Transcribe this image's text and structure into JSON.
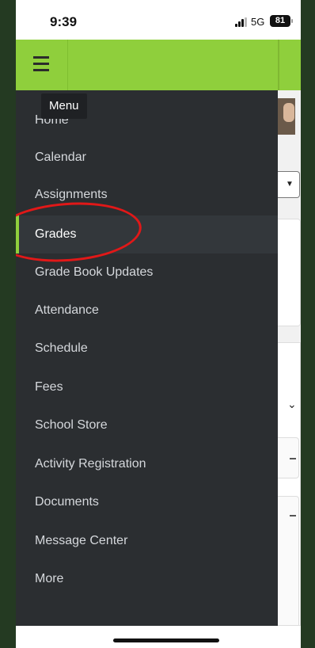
{
  "status_bar": {
    "time": "9:39",
    "network": "5G",
    "battery": "81"
  },
  "header": {
    "menu_icon": "hamburger-icon",
    "tooltip": "Menu",
    "accent_color": "#8fcf3c"
  },
  "drawer": {
    "items": [
      {
        "label": "Home",
        "active": false
      },
      {
        "label": "Calendar",
        "active": false
      },
      {
        "label": "Assignments",
        "active": false
      },
      {
        "label": "Grades",
        "active": true
      },
      {
        "label": "Grade Book Updates",
        "active": false
      },
      {
        "label": "Attendance",
        "active": false
      },
      {
        "label": "Schedule",
        "active": false
      },
      {
        "label": "Fees",
        "active": false
      },
      {
        "label": "School Store",
        "active": false
      },
      {
        "label": "Activity Registration",
        "active": false
      },
      {
        "label": "Documents",
        "active": false
      },
      {
        "label": "Message Center",
        "active": false
      },
      {
        "label": "More",
        "active": false
      }
    ]
  },
  "annotation": {
    "color": "#e11818"
  }
}
